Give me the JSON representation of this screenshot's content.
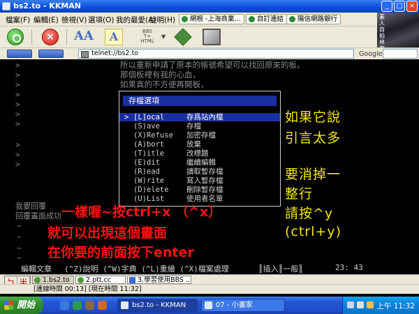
{
  "window": {
    "title": "bs2.to - KKMAN"
  },
  "menu": {
    "items": [
      "檔案(F)",
      "編輯(E)",
      "檢視(V)",
      "選項(O)",
      "我的最愛(A)",
      "說明(H)"
    ],
    "tabs": [
      "網根 -上海商業...",
      "自訂連結",
      "陽信網路銀行"
    ]
  },
  "toolbar": {
    "bbs_text": "BBS\nT+\nHTML"
  },
  "profile": {
    "text": "素人自拍林宥嘉"
  },
  "address": {
    "url": "telnet://bs2.to",
    "search_label": "Google"
  },
  "terminal": {
    "quote_marks": [
      ">",
      ">",
      ">",
      ">",
      ">",
      ">",
      ">",
      ">",
      ">",
      ">"
    ],
    "lines": [
      "所以重新申請了原本的帳號希望可以找回原來的板。",
      "那個板裡有我的心血，",
      "如果真的不方便再開板，"
    ],
    "dialog": {
      "title": "存檔選項",
      "options": [
        {
          "mark": ">",
          "key": "[L]ocal",
          "desc": "存爲站內檔"
        },
        {
          "mark": "",
          "key": "(S)ave",
          "desc": "存檔"
        },
        {
          "mark": "",
          "key": "(X)Refuse",
          "desc": "加密存檔"
        },
        {
          "mark": "",
          "key": "(A)bort",
          "desc": "放棄"
        },
        {
          "mark": "",
          "key": "(T)itle",
          "desc": "改標題"
        },
        {
          "mark": "",
          "key": "(E)dit",
          "desc": "繼續編輯"
        },
        {
          "mark": "",
          "key": "(R)ead",
          "desc": "讀取暫存檔"
        },
        {
          "mark": "",
          "key": "(W)rite",
          "desc": "寫入暫存檔"
        },
        {
          "mark": "",
          "key": "(D)elete",
          "desc": "刪除暫存檔"
        },
        {
          "mark": "",
          "key": "(U)List",
          "desc": "使用者名單"
        }
      ]
    },
    "yellow_notes": [
      "如果它說",
      "引言太多",
      "要消掉一",
      "整行",
      "請按^y",
      "(ctrl+y)"
    ],
    "red_notes": [
      "一樣喔~按ctrl+x （^x）",
      "就可以出現這個畫面",
      "在你要的前面按下enter"
    ],
    "bottom_left": [
      "我要回覆",
      "回覆畫面成功"
    ],
    "tildes": [
      "~",
      "~",
      "~",
      "~"
    ],
    "status": {
      "editing": "編輯文章",
      "help": "(^Z)說明 (^W)字典 (^L)重繪 (^X)檔案處理",
      "mode": "║插入║一般║",
      "pos": "23: 43"
    }
  },
  "tabs_strip": [
    "1.bs2.to",
    "2.ptt.cc",
    "3.學習使用BBS ..."
  ],
  "ime": [
    "ㄅ",
    "半"
  ],
  "statusbar": {
    "text": "[連線時間 00:13] [現在時間 11:32]"
  },
  "taskbar": {
    "start": "開始",
    "tasks": [
      "bs2.to - KKMAN",
      "07 - 小畫家"
    ],
    "clock": "上午 11:32"
  }
}
